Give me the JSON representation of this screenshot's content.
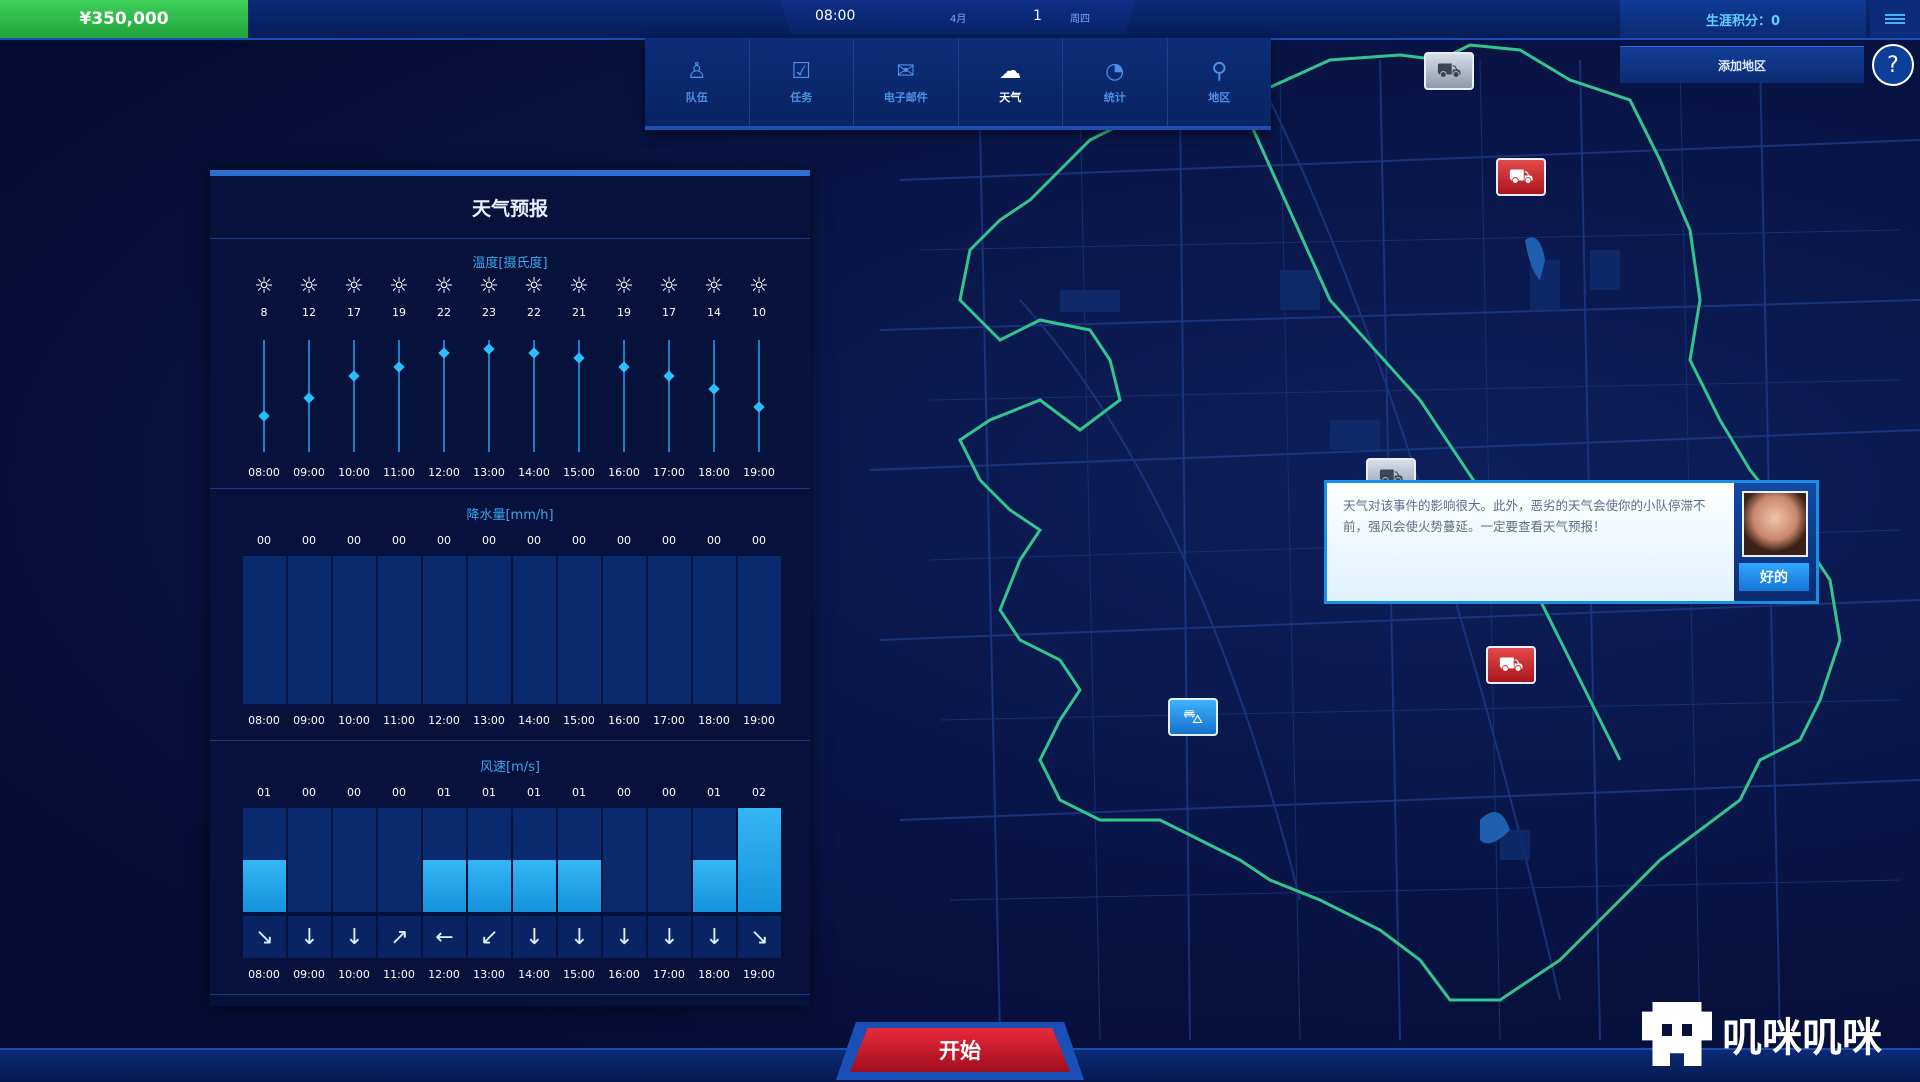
{
  "topbar": {
    "money": "¥350,000",
    "time": "08:00",
    "month": "4月",
    "day": "1",
    "weekday": "周四",
    "score": "生涯积分：0",
    "add_region": "添加地区",
    "help": "?"
  },
  "nav": [
    {
      "label": "队伍",
      "icon": "person-icon",
      "glyph": "♙"
    },
    {
      "label": "任务",
      "icon": "checkbox-icon",
      "glyph": "☑"
    },
    {
      "label": "电子邮件",
      "icon": "mail-icon",
      "glyph": "✉"
    },
    {
      "label": "天气",
      "icon": "cloud-icon",
      "glyph": "☁"
    },
    {
      "label": "统计",
      "icon": "pie-chart-icon",
      "glyph": "◔"
    },
    {
      "label": "地区",
      "icon": "map-pin-icon",
      "glyph": "⚲"
    }
  ],
  "weather": {
    "title": "天气预报",
    "temp_title": "温度[摄氏度]",
    "rain_title": "降水量[mm/h]",
    "wind_title": "风速[m/s]",
    "hours": [
      "08:00",
      "09:00",
      "10:00",
      "11:00",
      "12:00",
      "13:00",
      "14:00",
      "15:00",
      "16:00",
      "17:00",
      "18:00",
      "19:00"
    ],
    "temperatures": [
      "8",
      "12",
      "17",
      "19",
      "22",
      "23",
      "22",
      "21",
      "19",
      "17",
      "14",
      "10"
    ],
    "rain_labels": [
      "00",
      "00",
      "00",
      "00",
      "00",
      "00",
      "00",
      "00",
      "00",
      "00",
      "00",
      "00"
    ],
    "wind_labels": [
      "01",
      "00",
      "00",
      "00",
      "01",
      "01",
      "01",
      "01",
      "00",
      "00",
      "01",
      "02"
    ],
    "wind_arrows": [
      "↘",
      "↓",
      "↓",
      "↗",
      "←",
      "↙",
      "↓",
      "↓",
      "↓",
      "↓",
      "↓",
      "↘"
    ]
  },
  "dialog": {
    "text": "天气对该事件的影响很大。此外，恶劣的天气会使你的小队停滞不前，强风会使火势蔓延。一定要查看天气预报！",
    "ok": "好的"
  },
  "start": "开始",
  "watermark": "叽咪叽咪",
  "colors": {
    "accent": "#2ac0ff",
    "start_red": "#d61e30",
    "money_green": "#2fbf4a"
  }
}
